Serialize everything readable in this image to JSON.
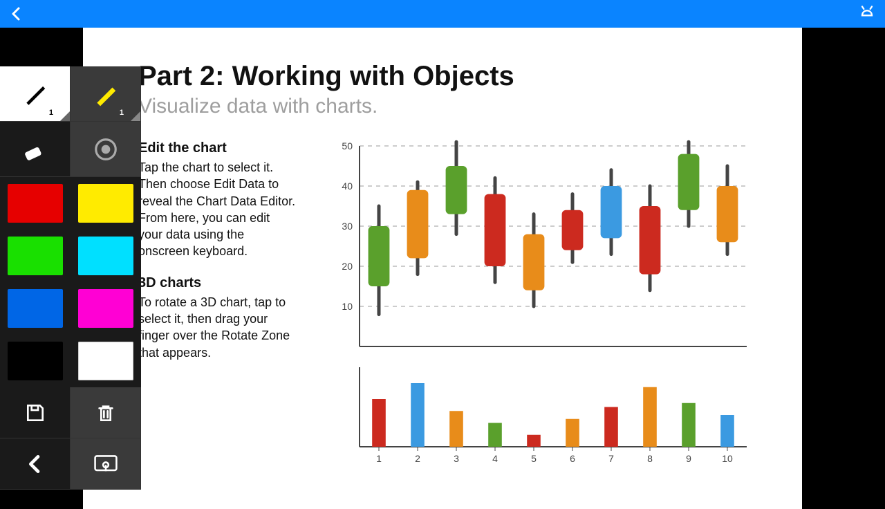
{
  "topbar": {
    "back_icon": "back-chevron",
    "robot_icon": "android-robot"
  },
  "tools": {
    "pen_sub": "1",
    "highlighter_sub": "1",
    "colors": [
      "#e60000",
      "#ffeb00",
      "#19e000",
      "#00e0ff",
      "#0066e6",
      "#ff00d4",
      "#000000",
      "#ffffff"
    ]
  },
  "document": {
    "title": "Part 2: Working with Objects",
    "subtitle": "Visualize data with charts.",
    "section1_h": "Edit the chart",
    "section1_p": "Tap the chart to select it. Then choose Edit Data to reveal the Chart Data Editor. From here, you can edit your data using the onscreen keyboard.",
    "section2_h": "3D charts",
    "section2_p": "To rotate a 3D chart, tap to select it, then drag your finger over the Rotate Zone that appears."
  },
  "chart_data": [
    {
      "type": "candlestick",
      "ylim": [
        0,
        50
      ],
      "yticks": [
        10,
        20,
        30,
        40,
        50
      ],
      "categories": [
        1,
        2,
        3,
        4,
        5,
        6,
        7,
        8,
        9,
        10
      ],
      "series": [
        {
          "low": 8,
          "high": 35,
          "open": 15,
          "close": 30,
          "color": "#5aa02c",
          "wick": "#444"
        },
        {
          "low": 18,
          "high": 41,
          "open": 22,
          "close": 39,
          "color": "#e88c1a",
          "wick": "#444"
        },
        {
          "low": 28,
          "high": 51,
          "open": 33,
          "close": 45,
          "color": "#5aa02c",
          "wick": "#444"
        },
        {
          "low": 16,
          "high": 42,
          "open": 20,
          "close": 38,
          "color": "#cc2a1f",
          "wick": "#444"
        },
        {
          "low": 10,
          "high": 33,
          "open": 14,
          "close": 28,
          "color": "#e88c1a",
          "wick": "#444"
        },
        {
          "low": 21,
          "high": 38,
          "open": 24,
          "close": 34,
          "color": "#cc2a1f",
          "wick": "#444"
        },
        {
          "low": 23,
          "high": 44,
          "open": 27,
          "close": 40,
          "color": "#3b9ae1",
          "wick": "#444"
        },
        {
          "low": 14,
          "high": 40,
          "open": 18,
          "close": 35,
          "color": "#cc2a1f",
          "wick": "#444"
        },
        {
          "low": 30,
          "high": 51,
          "open": 34,
          "close": 48,
          "color": "#5aa02c",
          "wick": "#444"
        },
        {
          "low": 23,
          "high": 45,
          "open": 26,
          "close": 40,
          "color": "#e88c1a",
          "wick": "#444"
        }
      ]
    },
    {
      "type": "bar",
      "categories": [
        1,
        2,
        3,
        4,
        5,
        6,
        7,
        8,
        9,
        10
      ],
      "values": [
        {
          "v": 60,
          "color": "#cc2a1f"
        },
        {
          "v": 80,
          "color": "#3b9ae1"
        },
        {
          "v": 45,
          "color": "#e88c1a"
        },
        {
          "v": 30,
          "color": "#5aa02c"
        },
        {
          "v": 15,
          "color": "#cc2a1f"
        },
        {
          "v": 35,
          "color": "#e88c1a"
        },
        {
          "v": 50,
          "color": "#cc2a1f"
        },
        {
          "v": 75,
          "color": "#e88c1a"
        },
        {
          "v": 55,
          "color": "#5aa02c"
        },
        {
          "v": 40,
          "color": "#3b9ae1"
        }
      ],
      "ylim": [
        0,
        100
      ],
      "xlabel_prefix": ""
    }
  ]
}
